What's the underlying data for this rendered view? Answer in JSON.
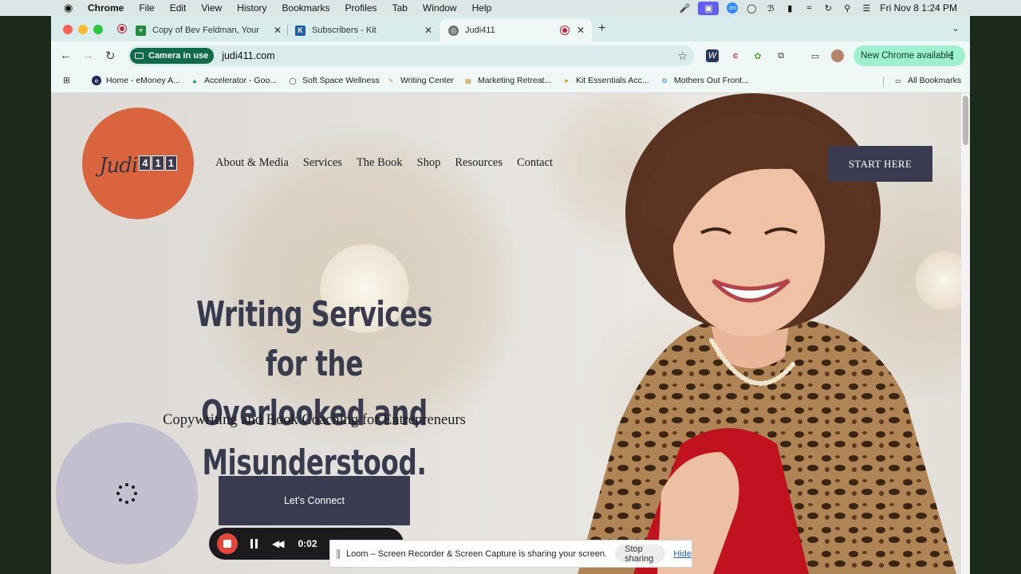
{
  "menubar": {
    "apple": "",
    "app_name": "Chrome",
    "items": [
      "File",
      "Edit",
      "View",
      "History",
      "Bookmarks",
      "Profiles",
      "Tab",
      "Window",
      "Help"
    ],
    "clock": "Fri Nov 8  1:24 PM"
  },
  "tabs": [
    {
      "title": "Copy of Bev Feldman, Your Pu",
      "favicon_color": "#1e8e3e"
    },
    {
      "title": "Subscribers - Kit",
      "favicon_color": "#1f5fa8"
    },
    {
      "title": "Judi411",
      "favicon_color": "#5f6368",
      "active": true
    }
  ],
  "toolbar": {
    "camera_chip": "Camera in use",
    "url": "judi411.com",
    "new_chrome": "New Chrome available"
  },
  "bookmarks": {
    "items": [
      "Home - eMoney A...",
      "Accelerator - Goo...",
      "Soft Space Wellness",
      "Writing Center",
      "Marketing Retreat...",
      "Kit Essentials Acc...",
      "Mothers Out Front..."
    ],
    "all_bookmarks": "All Bookmarks"
  },
  "site": {
    "logo_script": "Judi",
    "logo_digits": [
      "4",
      "1",
      "1"
    ],
    "nav": [
      "About & Media",
      "Services",
      "The Book",
      "Shop",
      "Resources",
      "Contact"
    ],
    "cta_top": "START HERE",
    "headline_line1": "Writing Services for the",
    "headline_line2": "Overlooked and Misunderstood.",
    "subheadline": "Copywriting and Book Coaching for Entrepreneurs",
    "cta_main": "Let's Connect",
    "brand_color": "#d9643e",
    "button_color": "#3a3b50"
  },
  "loom": {
    "timer": "0:02",
    "share_message": "Loom – Screen Recorder & Screen Capture is sharing your screen.",
    "stop_sharing": "Stop sharing",
    "hide": "Hide"
  }
}
